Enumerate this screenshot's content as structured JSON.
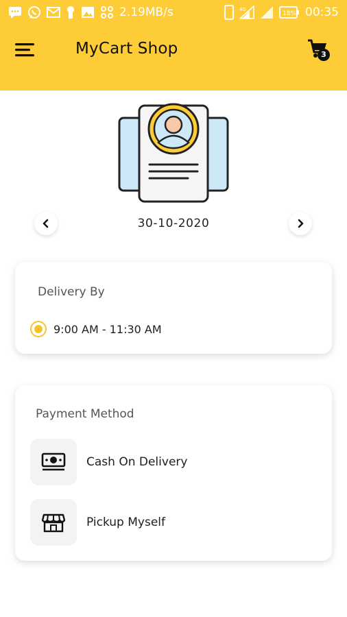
{
  "status_bar": {
    "network_speed": "2.19MB/s",
    "lte": "4G",
    "battery": "18%",
    "time": "00:35"
  },
  "app_bar": {
    "title": "MyCart Shop",
    "cart_count": "3"
  },
  "date_selector": {
    "date": "30-10-2020"
  },
  "delivery": {
    "title": "Delivery By",
    "slots": [
      {
        "label": "9:00 AM - 11:30 AM",
        "selected": true
      }
    ]
  },
  "payment": {
    "title": "Payment Method",
    "options": [
      {
        "label": "Cash On Delivery",
        "icon": "cash-icon"
      },
      {
        "label": "Pickup Myself",
        "icon": "store-icon"
      }
    ]
  },
  "colors": {
    "brand_yellow": "#FDCC36",
    "radio_yellow": "#F5C52A",
    "illustration_blue": "#CDE9F8",
    "illustration_paper": "#F5F5F5",
    "illustration_face": "#F7C9A6"
  }
}
